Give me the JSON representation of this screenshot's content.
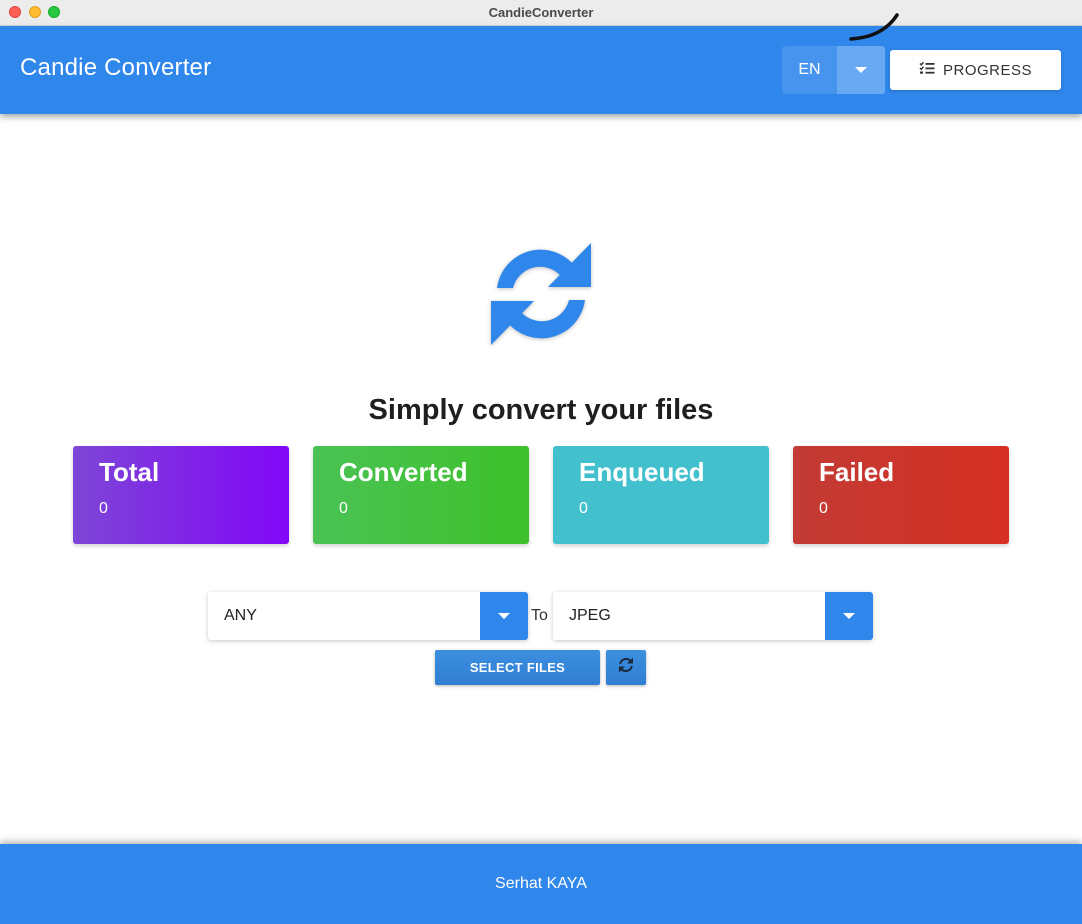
{
  "window": {
    "title": "CandieConverter"
  },
  "header": {
    "brand": "Candie Converter",
    "language": {
      "selected": "EN"
    },
    "progress_label": "PROGRESS"
  },
  "main": {
    "headline": "Simply convert your files",
    "stats": [
      {
        "label": "Total",
        "value": "0"
      },
      {
        "label": "Converted",
        "value": "0"
      },
      {
        "label": "Enqueued",
        "value": "0"
      },
      {
        "label": "Failed",
        "value": "0"
      }
    ],
    "from_format": "ANY",
    "to_label": "To",
    "to_format": "JPEG",
    "select_files_label": "SELECT FILES"
  },
  "footer": {
    "author": "Serhat KAYA"
  },
  "colors": {
    "accent": "#2f86eb",
    "total": "#8206f7",
    "converted": "#3ec12a",
    "enqueued": "#43c0ce",
    "failed": "#d63022"
  },
  "icons": [
    "sync-icon",
    "caret-down-icon",
    "list-check-icon",
    "refresh-icon"
  ]
}
